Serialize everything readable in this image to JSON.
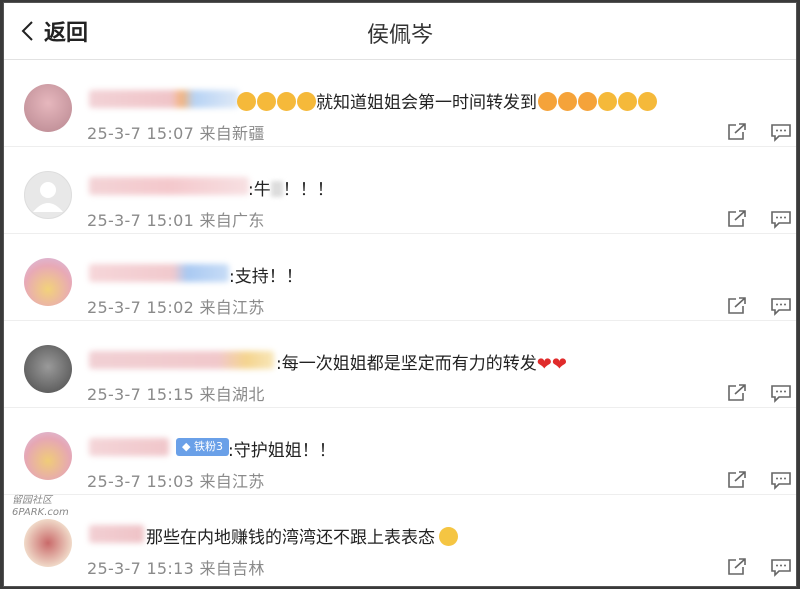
{
  "header": {
    "back_label": "返回",
    "title": "侯佩岑"
  },
  "comments": [
    {
      "text": "就知道姐姐会第一时间转发到",
      "time": "25-3-7 15:07",
      "location": "来自新疆"
    },
    {
      "text": ":牛",
      "text2": "！！！",
      "time": "25-3-7 15:01",
      "location": "来自广东"
    },
    {
      "text": ":支持！！",
      "time": "25-3-7 15:02",
      "location": "来自江苏"
    },
    {
      "text": ":每一次姐姐都是坚定而有力的转发",
      "time": "25-3-7 15:15",
      "location": "来自湖北"
    },
    {
      "text": ":守护姐姐！！",
      "badge": "铁粉3",
      "time": "25-3-7 15:03",
      "location": "来自江苏"
    },
    {
      "text": "那些在内地赚钱的湾湾还不跟上表表态",
      "time": "25-3-7 15:13",
      "location": "来自吉林"
    }
  ],
  "watermark": {
    "line1": "留园社区",
    "line2": "6PARK.com"
  },
  "icons": {
    "back": "chevron-left-icon",
    "share": "share-icon",
    "comment": "comment-icon"
  },
  "colors": {
    "meta_text": "#8a8a8a",
    "badge": "#6aa0e8",
    "heart": "#e02b2b",
    "emoji": "#f5b93a"
  }
}
